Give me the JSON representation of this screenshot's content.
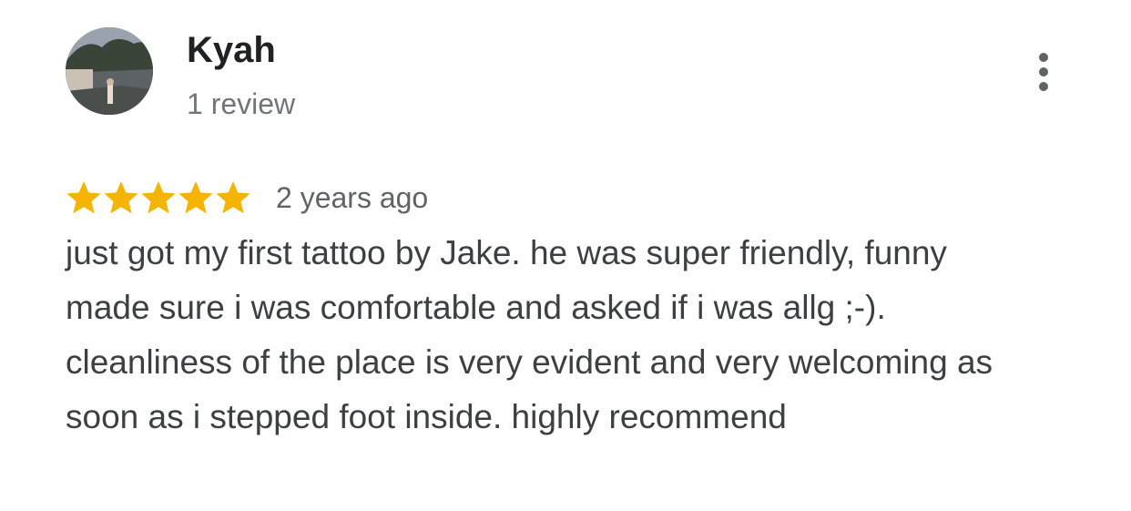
{
  "reviewer": {
    "name": "Kyah",
    "review_count": "1 review",
    "avatar_icon": "profile-photo"
  },
  "menu": {
    "icon": "more-vertical-icon"
  },
  "rating": {
    "stars": 5,
    "max_stars": 5,
    "star_color": "#f4b400",
    "date": "2 years ago"
  },
  "review": {
    "text": "just got my first tattoo by Jake. he was super friendly, funny made sure i was comfortable and asked if i was allg ;-). cleanliness of the place is very evident and very welcoming as soon as i stepped foot inside. highly recommend"
  }
}
